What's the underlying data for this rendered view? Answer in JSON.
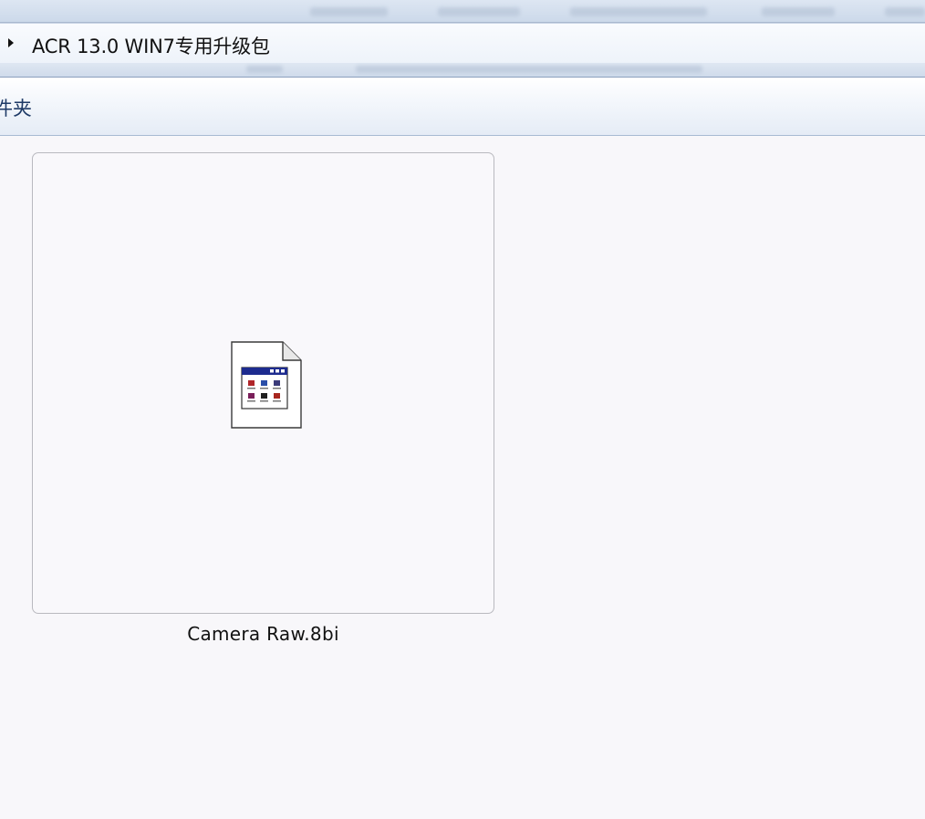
{
  "address_bar": {
    "path_text": "ACR 13.0 WIN7专用升级包"
  },
  "folder_header": {
    "title": "件夹"
  },
  "files": [
    {
      "name": "Camera Raw.8bi",
      "icon": "plugin-file-icon"
    }
  ]
}
